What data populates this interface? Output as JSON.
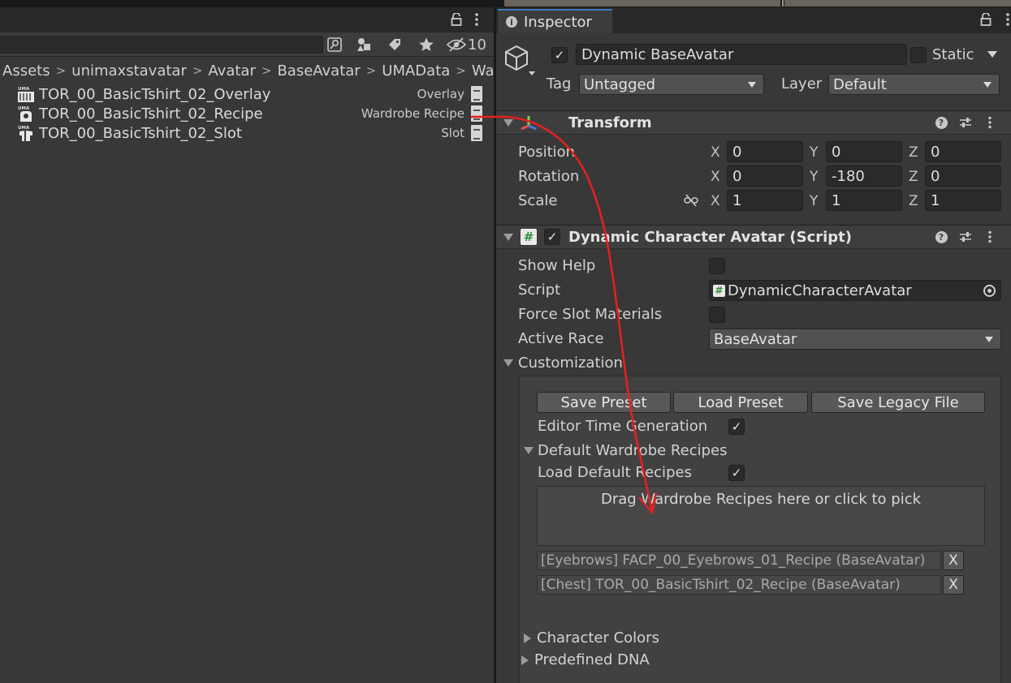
{
  "project": {
    "filter_count": "10",
    "breadcrumb": [
      "Assets",
      "unimaxstavatar",
      "Avatar",
      "BaseAvatar",
      "UMAData",
      "Ward"
    ],
    "assets": [
      {
        "name": "TOR_00_BasicTshirt_02_Overlay",
        "type": "Overlay",
        "icon": "uma-overlay-icon"
      },
      {
        "name": "TOR_00_BasicTshirt_02_Recipe",
        "type": "Wardrobe Recipe",
        "icon": "uma-recipe-icon"
      },
      {
        "name": "TOR_00_BasicTshirt_02_Slot",
        "type": "Slot",
        "icon": "uma-slot-icon"
      }
    ]
  },
  "inspector": {
    "tab_label": "Inspector",
    "object": {
      "name": "Dynamic BaseAvatar",
      "active": true,
      "static_label": "Static",
      "tag_label": "Tag",
      "tag_value": "Untagged",
      "layer_label": "Layer",
      "layer_value": "Default"
    },
    "transform": {
      "title": "Transform",
      "position_label": "Position",
      "rotation_label": "Rotation",
      "scale_label": "Scale",
      "position": {
        "x": "0",
        "y": "0",
        "z": "0"
      },
      "rotation": {
        "x": "0",
        "y": "-180",
        "z": "0"
      },
      "scale": {
        "x": "1",
        "y": "1",
        "z": "1"
      },
      "axis_x": "X",
      "axis_y": "Y",
      "axis_z": "Z"
    },
    "script_component": {
      "title": "Dynamic Character Avatar (Script)",
      "enabled": true,
      "show_help_label": "Show Help",
      "script_label": "Script",
      "script_value": "DynamicCharacterAvatar",
      "force_slot_label": "Force Slot Materials",
      "active_race_label": "Active Race",
      "active_race_value": "BaseAvatar",
      "customization_label": "Customization",
      "save_preset": "Save Preset",
      "load_preset": "Load Preset",
      "save_legacy": "Save Legacy File",
      "editor_time_label": "Editor Time Generation",
      "default_wardrobe_label": "Default Wardrobe Recipes",
      "load_default_label": "Load Default Recipes",
      "drop_hint": "Drag Wardrobe Recipes here or click to pick",
      "recipes": [
        "[Eyebrows] FACP_00_Eyebrows_01_Recipe (BaseAvatar)",
        "[Chest] TOR_00_BasicTshirt_02_Recipe (BaseAvatar)"
      ],
      "remove_label": "X",
      "character_colors_label": "Character Colors",
      "predefined_dna_label": "Predefined DNA"
    }
  },
  "colors": {
    "annotation_arrow": "#e8201f",
    "tab_accent": "#3a79bb"
  }
}
